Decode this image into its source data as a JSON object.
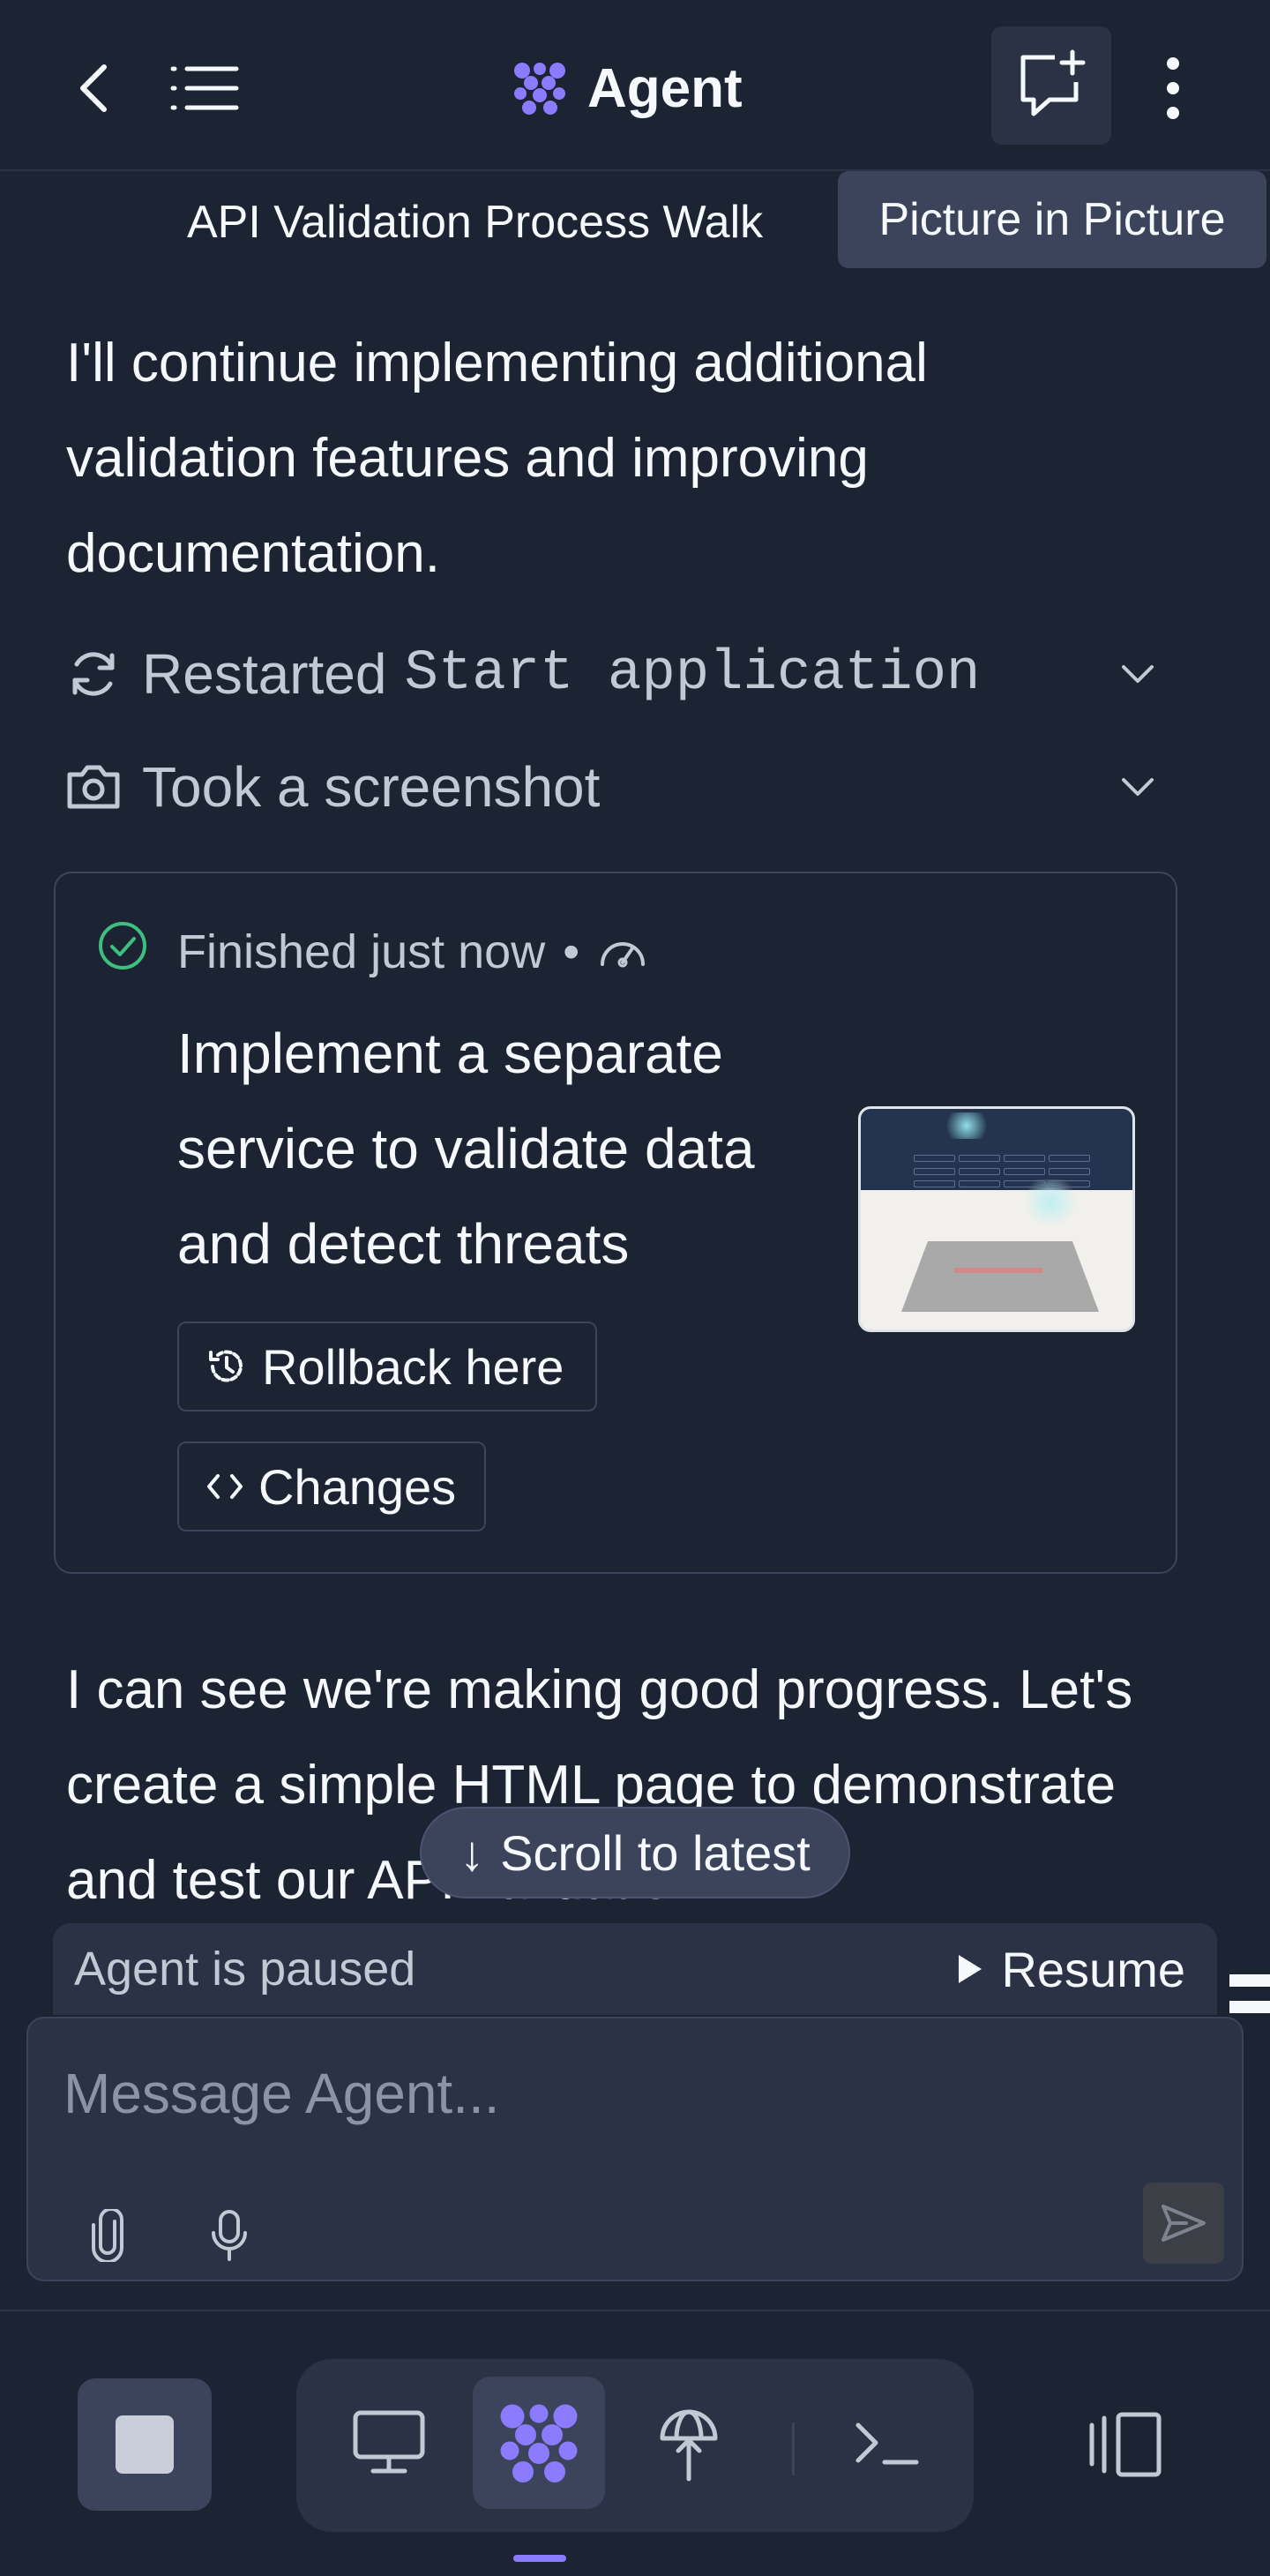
{
  "header": {
    "title": "Agent",
    "back_icon": "chevron-left-icon",
    "list_icon": "list-icon",
    "logo_icon": "agent-logo-icon",
    "new_chat_icon": "new-chat-icon",
    "more_icon": "more-vertical-icon"
  },
  "session": {
    "title": "API Validation Process Walk",
    "tooltip": "Picture in Picture"
  },
  "messages": {
    "first": "I'll continue implementing additional validation features and improving documentation.",
    "second": "I can see we're making good progress. Let's create a simple HTML page to demonstrate and test our API validation"
  },
  "actions": [
    {
      "icon": "restart-icon",
      "label": "Restarted",
      "code": "Start application"
    },
    {
      "icon": "camera-icon",
      "label": "Took a screenshot",
      "code": ""
    }
  ],
  "checkpoint": {
    "status": "Finished just now",
    "separator": "•",
    "description": "Implement a separate service to validate data and detect threats",
    "rollback_label": "Rollback here",
    "changes_label": "Changes"
  },
  "scroll_latest": {
    "label": "Scroll to latest",
    "arrow": "↓"
  },
  "paused": {
    "text": "Agent is paused",
    "resume_label": "Resume"
  },
  "composer": {
    "placeholder": "Message Agent..."
  },
  "colors": {
    "background": "#1c2333",
    "surface": "#2b3245",
    "border": "#3c445c",
    "accent": "#8a7bff",
    "success": "#3fbf7f"
  }
}
